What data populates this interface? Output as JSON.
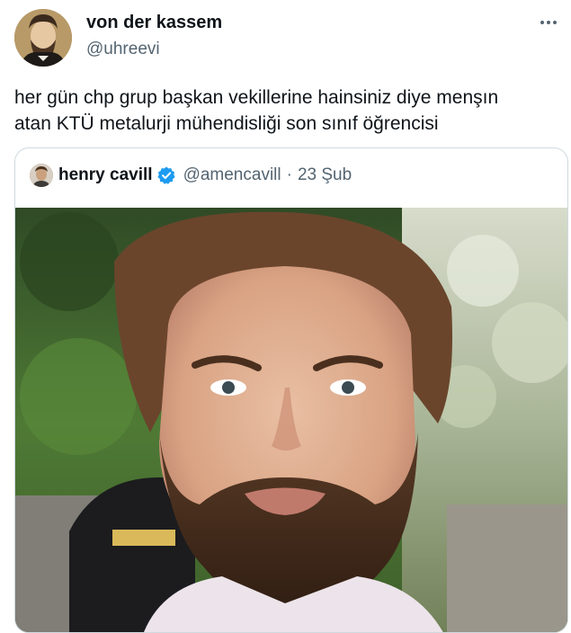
{
  "author": {
    "display_name": "von der kassem",
    "handle": "@uhreevi"
  },
  "menu": {
    "more_icon": "more-horizontal-icon"
  },
  "tweet": {
    "text_lines": [
      "her gün chp grup başkan vekillerine hainsiniz diye menşın",
      "atan KTÜ metalurji mühendisliği son sınıf öğrencisi"
    ]
  },
  "quote": {
    "display_name": "henry cavill",
    "verified_icon": "verified-badge-icon",
    "handle": "@amencavill",
    "separator": "·",
    "date": "23 Şub"
  },
  "colors": {
    "text_primary": "#0f1419",
    "text_secondary": "#536471",
    "border": "#cfd9de",
    "verified": "#1d9bf0"
  }
}
